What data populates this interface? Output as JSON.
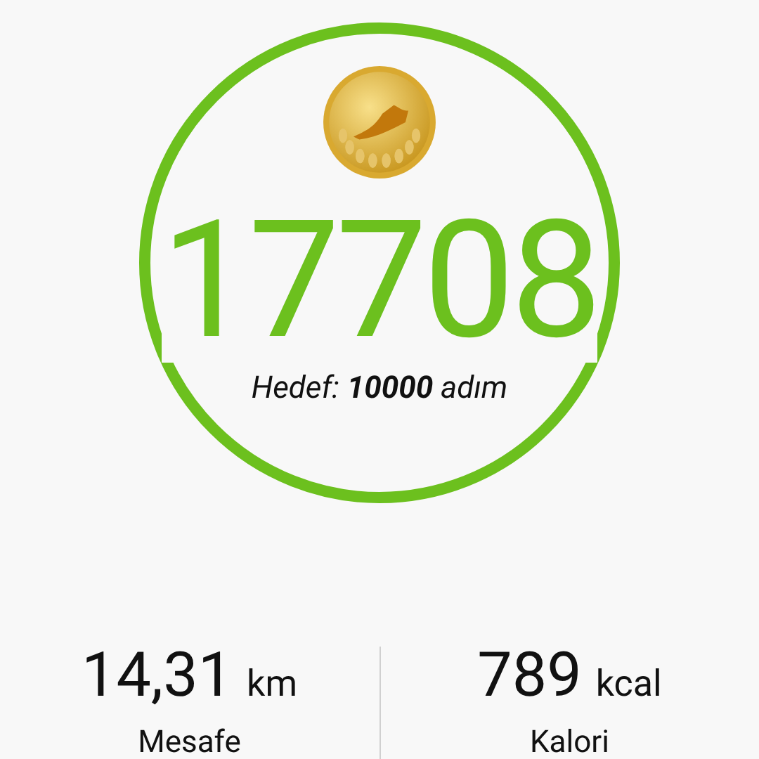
{
  "steps": {
    "count": "17708",
    "goal": "Hedef: **10000** adım"
  },
  "stats": [
    {
      "value": "14,31",
      "unit": "km",
      "label": "Mesafe"
    },
    {
      "value": "789",
      "unit": "kcal",
      "label": "Kalori"
    }
  ]
}
